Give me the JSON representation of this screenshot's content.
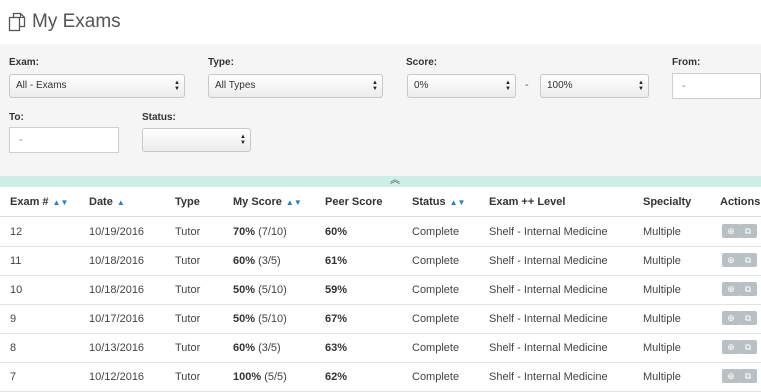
{
  "page": {
    "title": "My Exams"
  },
  "filters": {
    "exam": {
      "label": "Exam:",
      "value": "All - Exams"
    },
    "type": {
      "label": "Type:",
      "value": "All Types"
    },
    "score": {
      "label": "Score:",
      "min": "0%",
      "separator": "-",
      "max": "100%"
    },
    "from": {
      "label": "From:",
      "value": "-"
    },
    "to": {
      "label": "To:",
      "value": "-"
    },
    "status": {
      "label": "Status:",
      "value": ""
    }
  },
  "colors": {
    "accent": "#2a7fc0",
    "collapse_bar": "#cdeee4",
    "filter_bg": "#f5f5f5",
    "action_button": "#b8c0c3"
  },
  "table": {
    "columns": [
      "Exam #",
      "Date",
      "Type",
      "My Score",
      "Peer Score",
      "Status",
      "Exam ++ Level",
      "Specialty",
      "Actions"
    ],
    "rows": [
      {
        "exam": "12",
        "date": "10/19/2016",
        "type": "Tutor",
        "score_pct": "70%",
        "score_frac": "(7/10)",
        "peer": "60%",
        "status": "Complete",
        "level": "Shelf - Internal Medicine",
        "specialty": "Multiple"
      },
      {
        "exam": "11",
        "date": "10/18/2016",
        "type": "Tutor",
        "score_pct": "60%",
        "score_frac": "(3/5)",
        "peer": "61%",
        "status": "Complete",
        "level": "Shelf - Internal Medicine",
        "specialty": "Multiple"
      },
      {
        "exam": "10",
        "date": "10/18/2016",
        "type": "Tutor",
        "score_pct": "50%",
        "score_frac": "(5/10)",
        "peer": "59%",
        "status": "Complete",
        "level": "Shelf - Internal Medicine",
        "specialty": "Multiple"
      },
      {
        "exam": "9",
        "date": "10/17/2016",
        "type": "Tutor",
        "score_pct": "50%",
        "score_frac": "(5/10)",
        "peer": "67%",
        "status": "Complete",
        "level": "Shelf - Internal Medicine",
        "specialty": "Multiple"
      },
      {
        "exam": "8",
        "date": "10/13/2016",
        "type": "Tutor",
        "score_pct": "60%",
        "score_frac": "(3/5)",
        "peer": "63%",
        "status": "Complete",
        "level": "Shelf - Internal Medicine",
        "specialty": "Multiple"
      },
      {
        "exam": "7",
        "date": "10/12/2016",
        "type": "Tutor",
        "score_pct": "100%",
        "score_frac": "(5/5)",
        "peer": "62%",
        "status": "Complete",
        "level": "Shelf - Internal Medicine",
        "specialty": "Multiple"
      }
    ]
  }
}
